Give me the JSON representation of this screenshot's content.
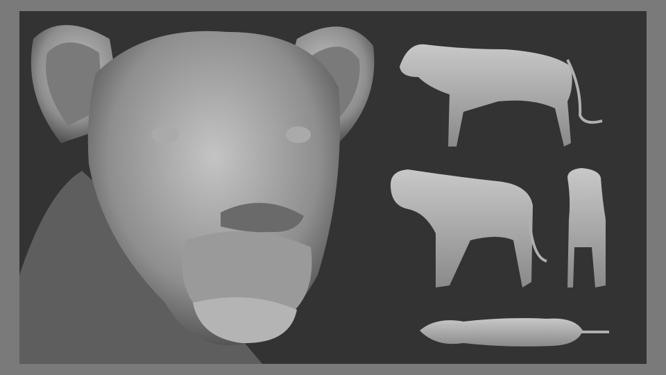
{
  "colors": {
    "frame": "#7a7a7a",
    "background": "#333333",
    "sculpt_light": "#bdbdbd",
    "sculpt_mid": "#8f8f8f",
    "sculpt_dark": "#5a5a5a"
  },
  "views": [
    "head-closeup",
    "side-view",
    "three-quarter-view",
    "front-view",
    "top-view"
  ]
}
